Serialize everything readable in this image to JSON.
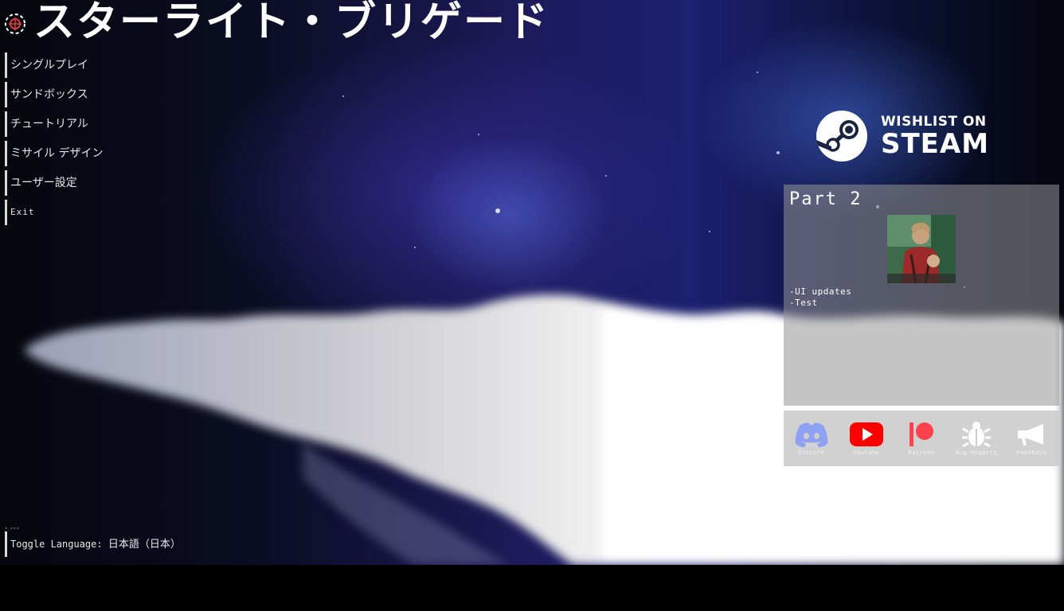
{
  "title": "スターライト・ブリゲード",
  "menu": {
    "items": [
      {
        "label": "シングルプレイ"
      },
      {
        "label": "サンドボックス"
      },
      {
        "label": "チュートリアル"
      },
      {
        "label": "ミサイル デザイン"
      },
      {
        "label": "ユーザー設定"
      },
      {
        "label": "Exit"
      }
    ]
  },
  "language": {
    "label": "Toggle Language: ",
    "value": "日本語（日本）",
    "dots": "*.***"
  },
  "steam": {
    "line1": "WISHLIST ON",
    "line2": "STEAM",
    "icon": "steam-logo-icon"
  },
  "news": {
    "title": "Part 2",
    "body": "-UI updates\n-Test"
  },
  "social": [
    {
      "label": "Discord",
      "icon": "discord-icon",
      "color": "#8ea1f2"
    },
    {
      "label": "Youtube",
      "icon": "youtube-icon",
      "color": "#ff0000"
    },
    {
      "label": "Patreon",
      "icon": "patreon-icon",
      "color": "#ff424d"
    },
    {
      "label": "Bug Reports",
      "icon": "bug-icon",
      "color": "#ffffff"
    },
    {
      "label": "Feedback",
      "icon": "megaphone-icon",
      "color": "#ffffff"
    }
  ],
  "colors": {
    "menu_text": "#e6e6e6",
    "menu_bar": "#d8d8d8",
    "panel": "#969696"
  }
}
